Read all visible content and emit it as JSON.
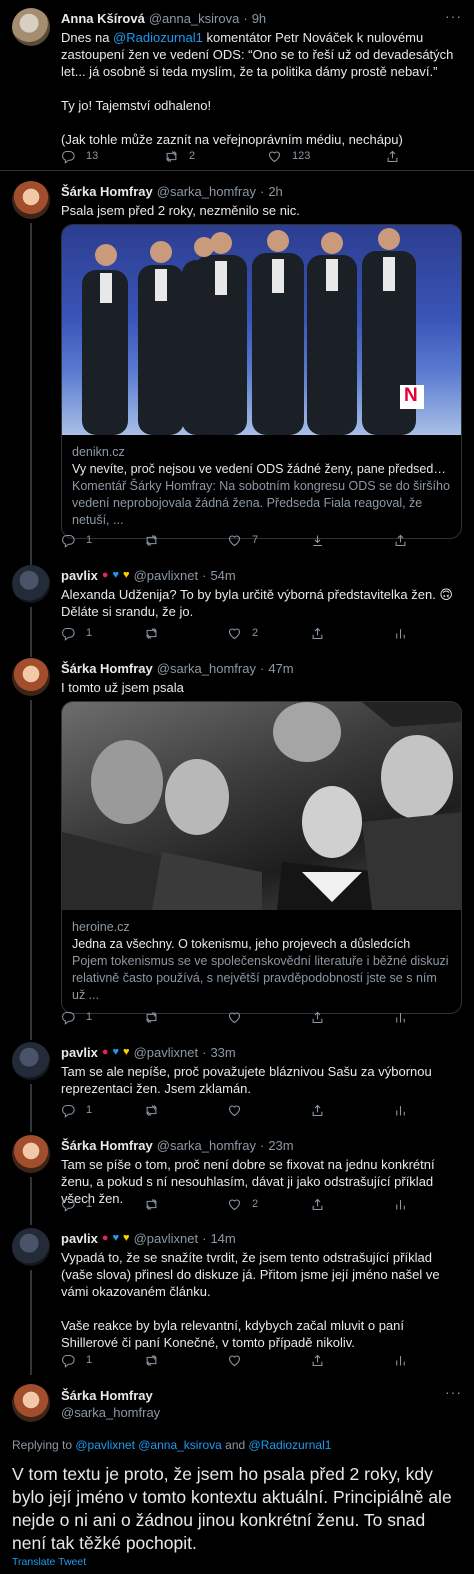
{
  "colors": {
    "accent": "#1d9bf0",
    "muted": "#8b98a5",
    "background": "#000000",
    "text": "#e7e9ea"
  },
  "icons": {
    "reply": "reply-icon",
    "retweet": "retweet-icon",
    "like": "like-icon",
    "share": "share-icon",
    "download": "download-icon",
    "analytics": "analytics-icon",
    "more": "more-icon"
  },
  "tweets": [
    {
      "name": "Anna Kšírová",
      "handle": "@anna_ksirova",
      "time": "9h",
      "text_pre": "Dnes na ",
      "mention": "@Radiozurnal1",
      "text_post": " komentátor Petr Nováček k nulovému zastoupení žen ve vedení ODS: “Ono se to řeší už od devadesátých let... já osobně si teda myslím, že ta politika dámy prostě nebaví.”\n\nTy jo! Tajemství odhaleno!\n\n(Jak tohle může zaznít na veřejnoprávním médiu, nechápu)",
      "replies": "13",
      "retweets": "2",
      "likes": "123"
    },
    {
      "name": "Šárka Homfray",
      "handle": "@sarka_homfray",
      "time": "2h",
      "text": "Psala jsem před 2 roky, nezměnilo se nic.",
      "card": {
        "domain": "denikn.cz",
        "title": "Vy nevíte, proč nejsou ve vedení ODS žádné ženy, pane předsedo? Ta...",
        "desc": "Komentář Šárky Homfray: Na sobotním kongresu ODS se do širšího vedení neprobojovala žádná žena. Předseda Fiala reagoval, že netuší, ...",
        "logo": "N"
      },
      "replies": "1",
      "likes": "7"
    },
    {
      "name": "pavlix",
      "handle": "@pavlixnet",
      "time": "54m",
      "text": "Alexanda Udženija? To by byla určitě výborná představitelka žen. 🙃 Děláte si srandu, že jo.",
      "replies": "1",
      "likes": "2"
    },
    {
      "name": "Šárka Homfray",
      "handle": "@sarka_homfray",
      "time": "47m",
      "text": "I tomto už jsem psala",
      "card": {
        "domain": "heroine.cz",
        "title": "Jedna za všechny. O tokenismu, jeho projevech a důsledcích",
        "desc": "Pojem tokenismus se ve společenskovědní literatuře i běžné diskuzi relativně často používá, s největší pravděpodobností jste se s ním už ..."
      },
      "replies": "1"
    },
    {
      "name": "pavlix",
      "handle": "@pavlixnet",
      "time": "33m",
      "text": "Tam se ale nepíše, proč považujete bláznivou Sašu za výbornou reprezentaci žen. Jsem zklamán.",
      "replies": "1"
    },
    {
      "name": "Šárka Homfray",
      "handle": "@sarka_homfray",
      "time": "23m",
      "text": "Tam se píše o tom, proč není dobre se fixovat na jednu konkrétní ženu, a pokud s ní nesouhlasím, dávat ji jako odstrašující příklad všech žen.",
      "replies": "1",
      "likes": "2"
    },
    {
      "name": "pavlix",
      "handle": "@pavlixnet",
      "time": "14m",
      "text": "Vypadá to, že se snažíte tvrdit, že jsem tento odstrašující příklad (vaše slova) přinesl do diskuze já. Přitom jsme její jméno našel ve vámi okazovaném článku.\n\nVaše reakce by byla relevantní, kdybych začal mluvit o paní Shillerové či paní Konečné, v tomto případě nikoliv.",
      "replies": "1"
    }
  ],
  "main": {
    "name": "Šárka Homfray",
    "handle": "@sarka_homfray",
    "replying_label": "Replying to ",
    "replying_mentions": "@pavlixnet @anna_ksirova",
    "replying_and": " and ",
    "replying_last": "@Radiozurnal1",
    "text": "V tom textu je proto, že jsem ho psala před 2 roky, kdy bylo její jméno v tomto kontextu aktuální. Principiálně ale nejde o ni ani o žádnou jinou konkrétní ženu. To snad není tak těžké pochopit.",
    "translate": "Translate Tweet"
  },
  "more_glyph": "···",
  "sep": "·"
}
